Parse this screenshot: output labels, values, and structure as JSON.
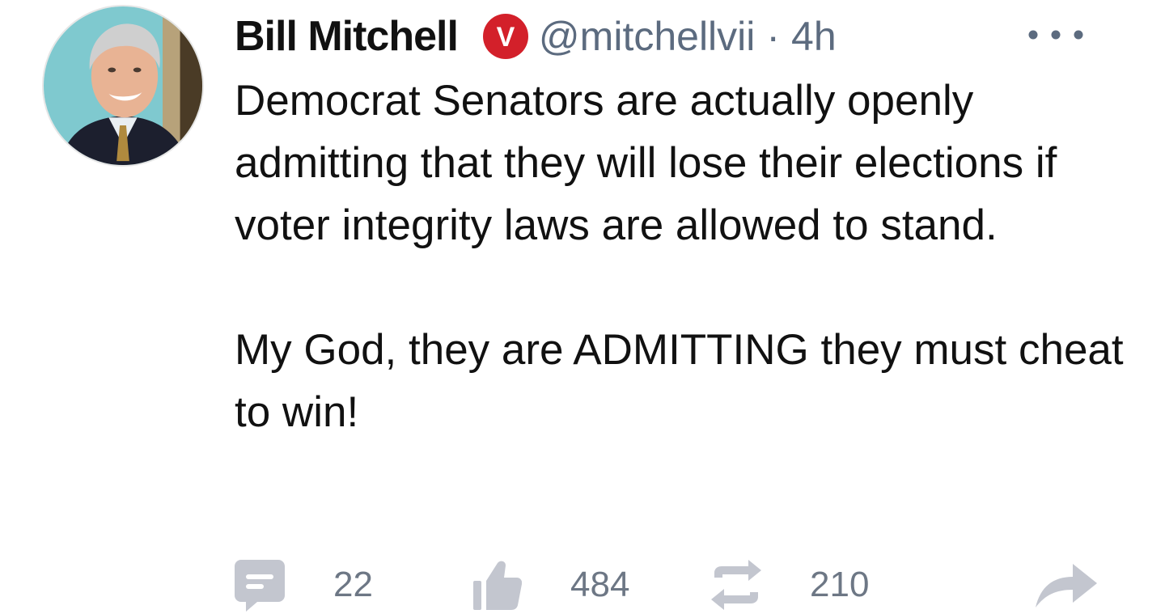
{
  "tweet": {
    "display_name": "Bill Mitchell",
    "badge_letter": "V",
    "handle": "@mitchellvii",
    "separator": "·",
    "time": "4h",
    "text_paragraph_1": "Democrat Senators are actually openly admitting that they will lose their elections if voter integrity laws are allowed to stand.",
    "text_paragraph_2": "My God, they are ADMITTING they must cheat to win!"
  },
  "actions": {
    "reply_count": "22",
    "like_count": "484",
    "retweet_count": "210"
  },
  "icons": {
    "avatar": "profile-photo",
    "badge": "verified-v-badge",
    "more": "more-dots-icon",
    "reply": "comment-icon",
    "like": "thumbs-up-icon",
    "retweet": "retweet-icon",
    "share": "share-arrow-icon"
  },
  "colors": {
    "badge_red": "#d3202a",
    "secondary_text": "#5c6b7f",
    "icon_gray": "#c3c6cf",
    "count_gray": "#6d7785"
  }
}
